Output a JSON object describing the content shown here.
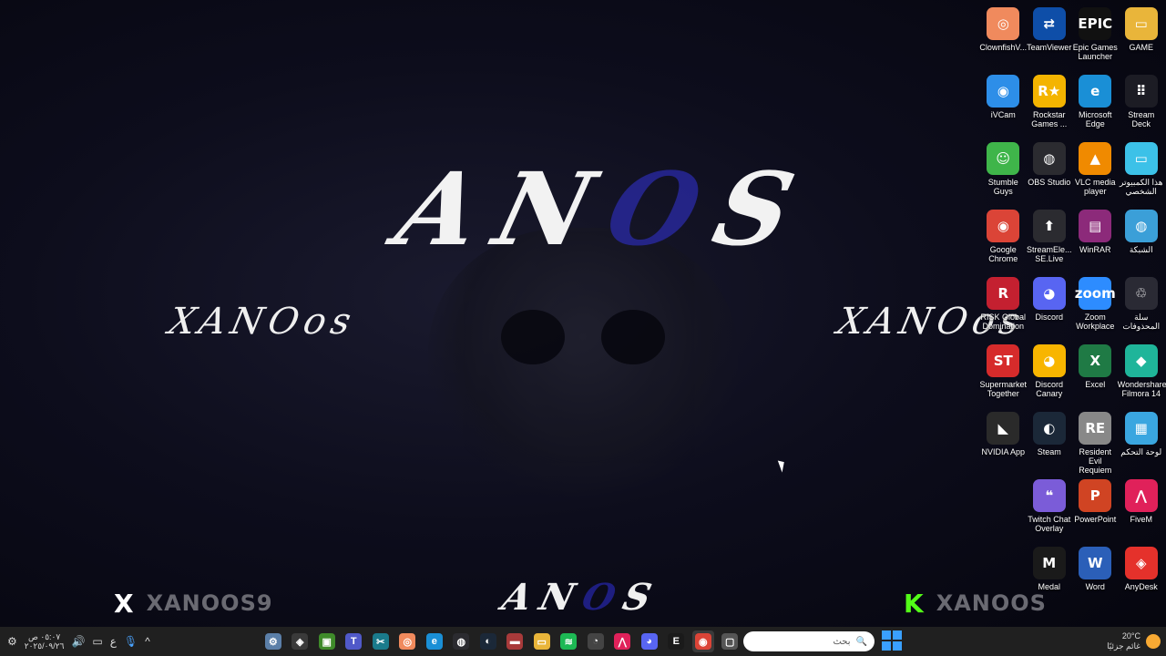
{
  "wallpaper": {
    "brand_a": "AN",
    "brand_o": "O",
    "brand_s": "S",
    "tag_left": "XANOos",
    "tag_right": "XANOos",
    "social_x_symbol": "X",
    "social_x_text": "XANOOS9",
    "social_k_symbol": "K",
    "social_k_text": "XANOOS",
    "brand_small_a": "AN",
    "brand_small_o": "O",
    "brand_small_s": "S",
    "accent": "#2a2aa8"
  },
  "desktop_icons": [
    {
      "label": "ClownfishV...",
      "glyph": "◎",
      "color": "#f08a5d"
    },
    {
      "label": "TeamViewer",
      "glyph": "⇄",
      "color": "#0e4ea8"
    },
    {
      "label": "Epic Games Launcher",
      "glyph": "EPIC",
      "color": "#111111"
    },
    {
      "label": "GAME",
      "glyph": "▭",
      "color": "#e9b53a"
    },
    {
      "label": "iVCam",
      "glyph": "◉",
      "color": "#2d8ee8"
    },
    {
      "label": "Rockstar Games ...",
      "glyph": "R★",
      "color": "#f4b400"
    },
    {
      "label": "Microsoft Edge",
      "glyph": "e",
      "color": "#1a8fd6"
    },
    {
      "label": "Stream Deck",
      "glyph": "⠿",
      "color": "#1c1c24"
    },
    {
      "label": "Stumble Guys",
      "glyph": "☺",
      "color": "#3fb54a"
    },
    {
      "label": "OBS Studio",
      "glyph": "◍",
      "color": "#2b2b30"
    },
    {
      "label": "VLC media player",
      "glyph": "▲",
      "color": "#f08a00"
    },
    {
      "label": "هذا الكمبيوتر الشخصي",
      "glyph": "▭",
      "color": "#3cc1e8"
    },
    {
      "label": "Google Chrome",
      "glyph": "◉",
      "color": "#db4437"
    },
    {
      "label": "StreamEle... SE.Live",
      "glyph": "⬆",
      "color": "#2b2b30"
    },
    {
      "label": "WinRAR",
      "glyph": "▤",
      "color": "#8c2a7a"
    },
    {
      "label": "الشبكة",
      "glyph": "◍",
      "color": "#3b9fd8"
    },
    {
      "label": "RISK Global Domination",
      "glyph": "R",
      "color": "#c42030"
    },
    {
      "label": "Discord",
      "glyph": "◕",
      "color": "#5865f2"
    },
    {
      "label": "Zoom Workplace",
      "glyph": "zoom",
      "color": "#2d8cff"
    },
    {
      "label": "سلة المحذوفات",
      "glyph": "♲",
      "color": "#2a2a34"
    },
    {
      "label": "Supermarket Together",
      "glyph": "ST",
      "color": "#d62b2b"
    },
    {
      "label": "Discord Canary",
      "glyph": "◕",
      "color": "#f8b500"
    },
    {
      "label": "Excel",
      "glyph": "X",
      "color": "#1f7a45"
    },
    {
      "label": "Wondershare Filmora 14",
      "glyph": "◆",
      "color": "#1fb59a"
    },
    {
      "label": "NVIDIA App",
      "glyph": "◣",
      "color": "#2a2a2a"
    },
    {
      "label": "Steam",
      "glyph": "◐",
      "color": "#1b2838"
    },
    {
      "label": "Resident Evil Requiem",
      "glyph": "RE",
      "color": "#888888"
    },
    {
      "label": "لوحة التحكم",
      "glyph": "▦",
      "color": "#3aa6e0"
    },
    {
      "label": "",
      "glyph": "",
      "color": "transparent"
    },
    {
      "label": "Twitch Chat Overlay",
      "glyph": "❝",
      "color": "#7b5cd8"
    },
    {
      "label": "PowerPoint",
      "glyph": "P",
      "color": "#d04423"
    },
    {
      "label": "FiveM",
      "glyph": "⋀",
      "color": "#e0215a"
    },
    {
      "label": "",
      "glyph": "",
      "color": "transparent"
    },
    {
      "label": "Medal",
      "glyph": "M",
      "color": "#1a1a1a"
    },
    {
      "label": "Word",
      "glyph": "W",
      "color": "#2b5fb8"
    },
    {
      "label": "AnyDesk",
      "glyph": "◈",
      "color": "#e5312b"
    }
  ],
  "taskbar": {
    "time": "٠٥:٠٧ ص",
    "date": "٢٠٢٥/٠٩/٢٦",
    "lang": "ع",
    "search_placeholder": "بحث",
    "weather_temp": "20°C",
    "weather_text": "غائم جزئيًا",
    "apps": [
      {
        "name": "settings-app",
        "glyph": "⚙",
        "color": "#5b7fa8"
      },
      {
        "name": "steam-deck-app",
        "glyph": "◈",
        "color": "#3a3a3a"
      },
      {
        "name": "minecraft-app",
        "glyph": "▣",
        "color": "#3f8b2a"
      },
      {
        "name": "teams-app",
        "glyph": "T",
        "color": "#5059c9"
      },
      {
        "name": "capcut-app",
        "glyph": "✂",
        "color": "#1a7b8c"
      },
      {
        "name": "clownfish-app",
        "glyph": "◎",
        "color": "#f08a5d"
      },
      {
        "name": "edge-app",
        "glyph": "e",
        "color": "#1a8fd6"
      },
      {
        "name": "obs-app",
        "glyph": "◍",
        "color": "#2b2b30"
      },
      {
        "name": "steam-app",
        "glyph": "◐",
        "color": "#1b2838"
      },
      {
        "name": "game-app",
        "glyph": "▬",
        "color": "#a83a3a"
      },
      {
        "name": "file-explorer-app",
        "glyph": "▭",
        "color": "#e9b53a"
      },
      {
        "name": "spotify-app",
        "glyph": "≋",
        "color": "#1db954"
      },
      {
        "name": "github-app",
        "glyph": "◔",
        "color": "#444444"
      },
      {
        "name": "fivem-app",
        "glyph": "⋀",
        "color": "#e0215a"
      },
      {
        "name": "discord-app",
        "glyph": "◕",
        "color": "#5865f2"
      },
      {
        "name": "epic-app",
        "glyph": "E",
        "color": "#1a1a1a"
      },
      {
        "name": "chrome-app",
        "glyph": "◉",
        "color": "#db4437"
      },
      {
        "name": "window-app",
        "glyph": "▢",
        "color": "#555555"
      }
    ]
  }
}
